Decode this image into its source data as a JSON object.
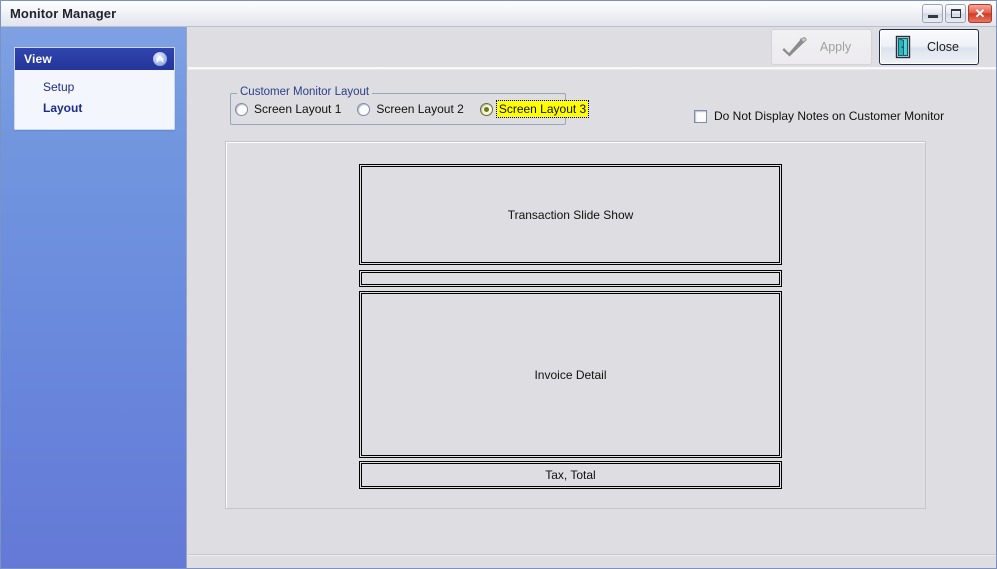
{
  "window": {
    "title": "Monitor Manager",
    "controls": {
      "minimize": "Minimize",
      "maximize": "Maximize",
      "close": "✕"
    }
  },
  "sidebar": {
    "panel": {
      "header": "View",
      "collapse_icon": "chevron-up-circle-icon",
      "items": [
        {
          "label": "Setup",
          "selected": false
        },
        {
          "label": "Layout",
          "selected": true
        }
      ]
    }
  },
  "toolbar": {
    "apply": {
      "label": "Apply",
      "icon": "check-brush-icon",
      "enabled": false
    },
    "close": {
      "label": "Close",
      "icon": "exit-door-icon",
      "enabled": true,
      "focused": true
    }
  },
  "main": {
    "group": {
      "legend": "Customer Monitor Layout",
      "radios": [
        {
          "label": "Screen Layout 1",
          "selected": false
        },
        {
          "label": "Screen Layout 2",
          "selected": false
        },
        {
          "label": "Screen Layout 3",
          "selected": true
        }
      ]
    },
    "checkbox": {
      "label": "Do Not Display Notes on Customer Monitor",
      "checked": false
    },
    "preview": {
      "panels": [
        {
          "label": "Transaction Slide Show"
        },
        {
          "label": ""
        },
        {
          "label": "Invoice Detail"
        },
        {
          "label": "Tax, Total"
        }
      ]
    }
  },
  "colors": {
    "sidebar_top": "#7fa1e3",
    "sidebar_bottom": "#6479d6",
    "panel_header": "#2a3da4",
    "content_bg": "#dedde2",
    "highlight": "#ffff00",
    "legend_text": "#2b3f86",
    "link_text": "#1d2c8c"
  }
}
